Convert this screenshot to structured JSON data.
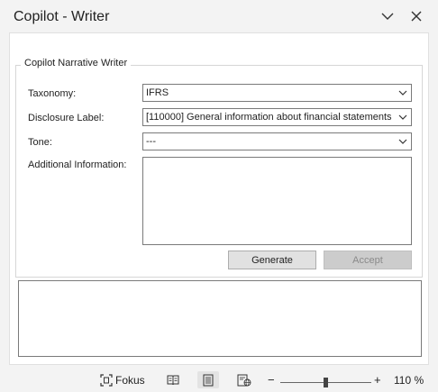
{
  "pane": {
    "title": "Copilot - Writer",
    "icons": {
      "collapse": "chevron-down-icon",
      "close": "close-icon"
    }
  },
  "form": {
    "group_title": "Copilot Narrative Writer",
    "taxonomy": {
      "label": "Taxonomy:",
      "value": "IFRS"
    },
    "disclosure": {
      "label": "Disclosure Label:",
      "value": "[110000] General information about financial statements"
    },
    "tone": {
      "label": "Tone:",
      "value": "---"
    },
    "additional": {
      "label": "Additional Information:",
      "value": ""
    },
    "generate_label": "Generate",
    "accept_label": "Accept",
    "output_text": ""
  },
  "statusbar": {
    "focus_label": "Fokus",
    "zoom_minus": "−",
    "zoom_plus": "+",
    "zoom_level": "110 %",
    "zoom_fraction": 0.5,
    "icons": [
      "focus-icon",
      "read-mode-icon",
      "print-layout-icon",
      "web-layout-icon"
    ]
  }
}
